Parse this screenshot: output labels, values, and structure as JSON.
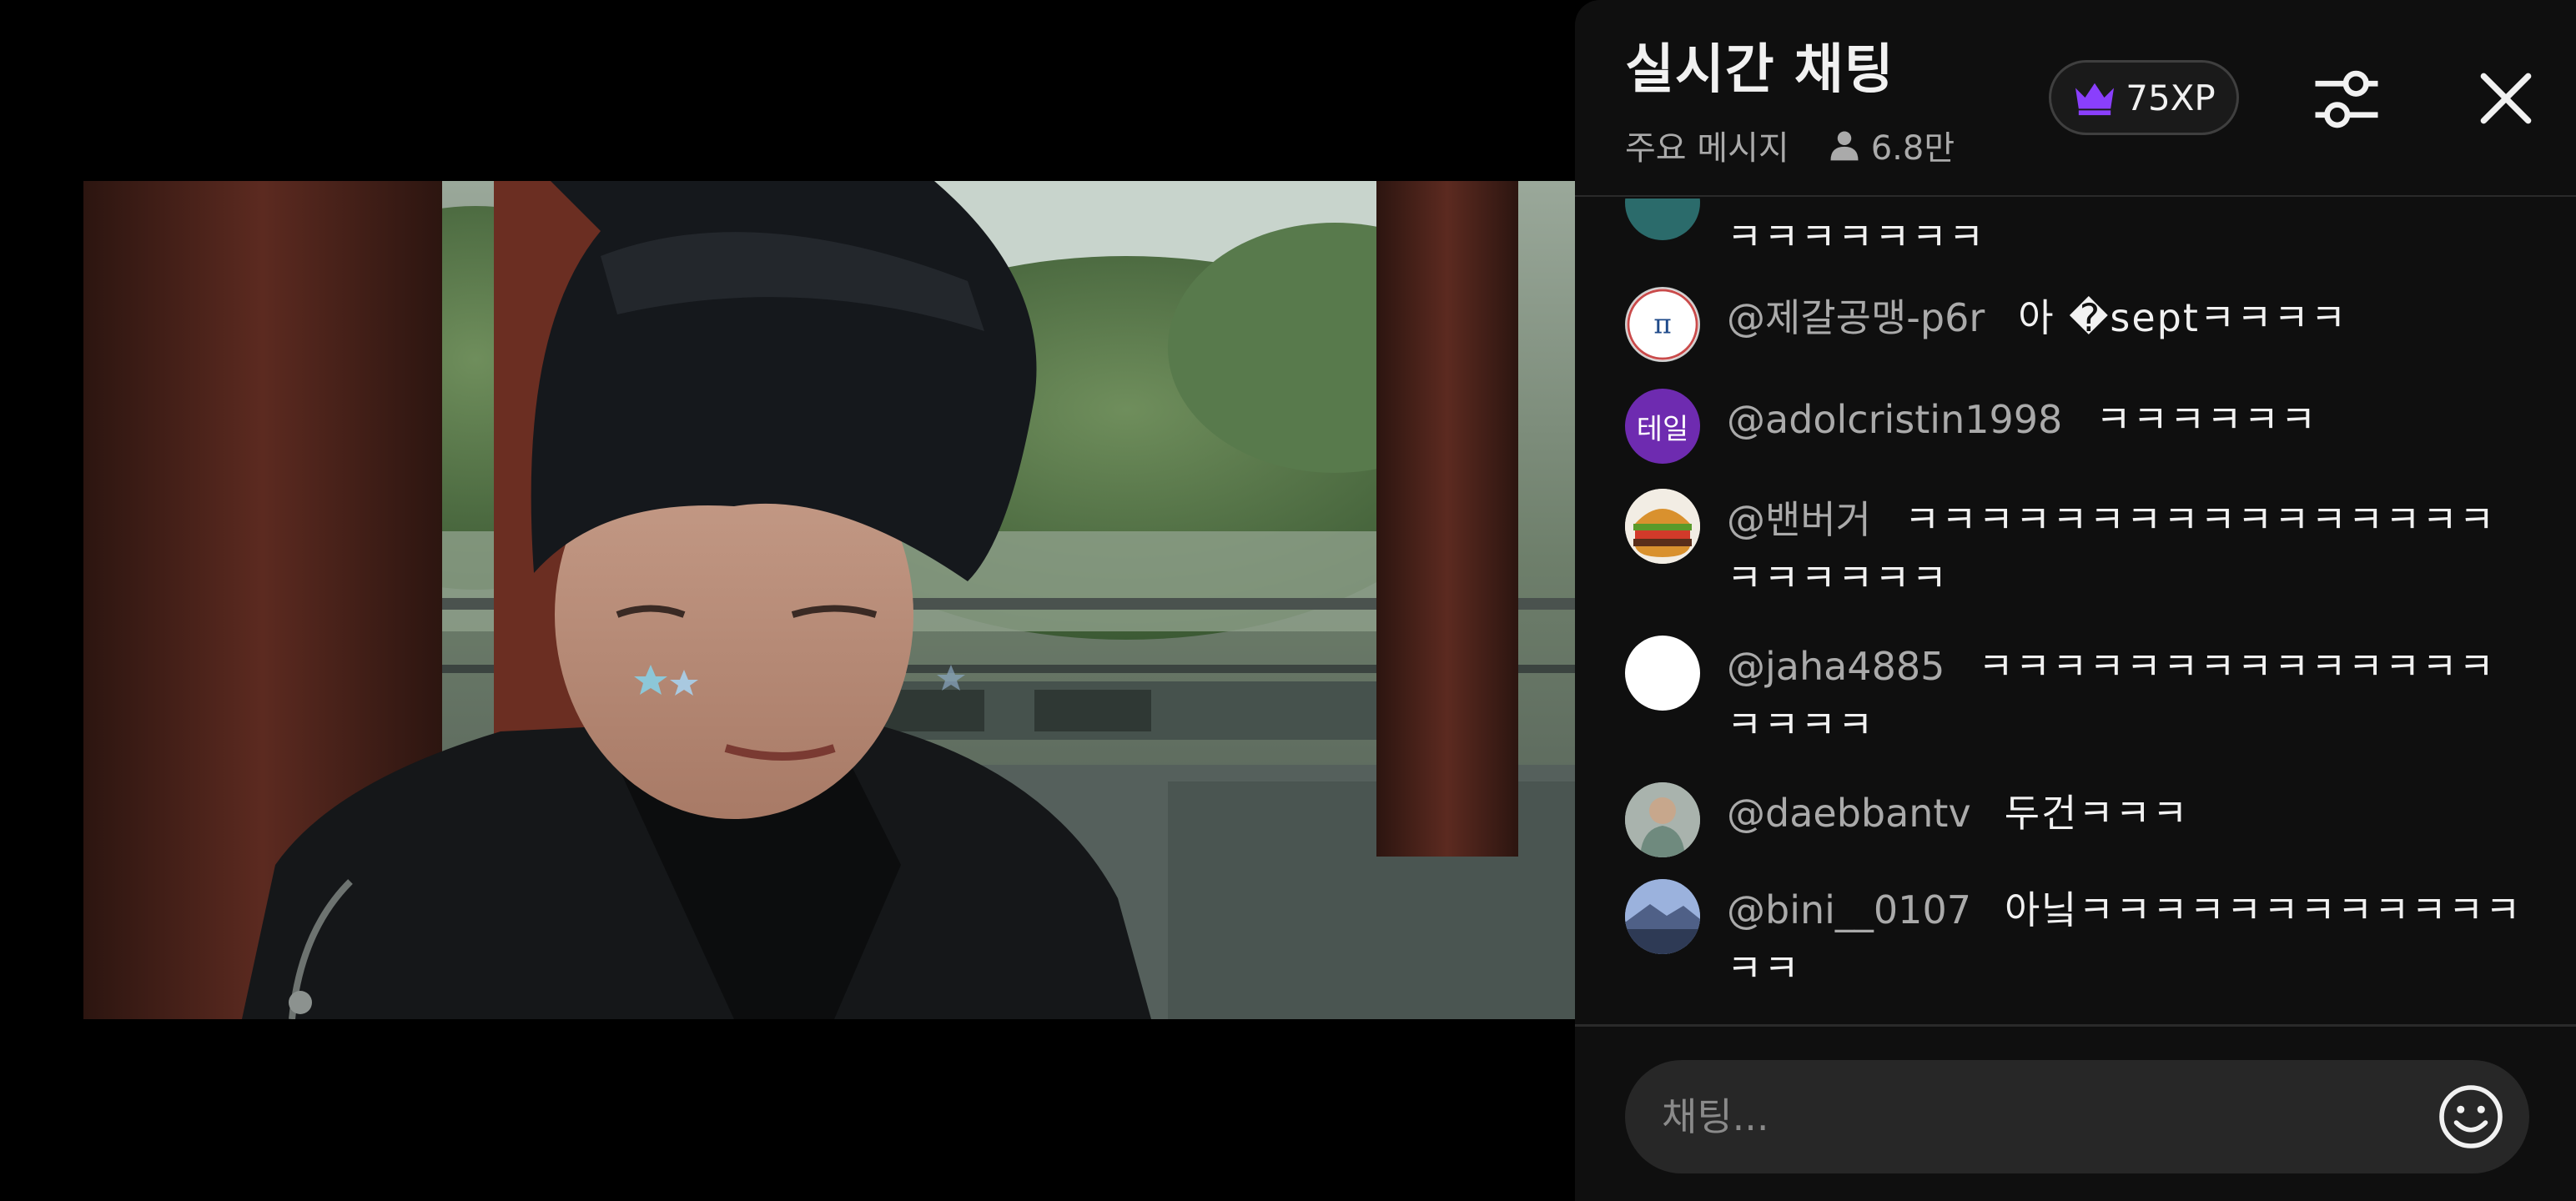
{
  "video": {
    "player_label": "video-player"
  },
  "chat": {
    "title": "실시간 채팅",
    "mode": "주요 메시지",
    "viewer_count": "6.8만",
    "xp_badge": "75XP",
    "icons": {
      "xp": "crown-icon",
      "filter": "sliders-icon",
      "close": "close-icon",
      "viewer": "person-icon",
      "emoji": "emoji-icon"
    },
    "partial_message": {
      "text": "ㅋㅋㅋㅋㅋㅋㅋ"
    },
    "messages": [
      {
        "author": "@제갈공맹-p6r",
        "text": "아 �septㅋㅋㅋㅋ",
        "avatar": "pi-logo"
      },
      {
        "author": "@adolcristin1998",
        "text": "ㅋㅋㅋㅋㅋㅋ",
        "avatar": "text-badge",
        "avatar_text": "테일",
        "avatar_color": "#6e2bb0"
      },
      {
        "author": "@밴버거",
        "text": "ㅋㅋㅋㅋㅋㅋㅋㅋㅋㅋㅋㅋㅋㅋㅋㅋㅋㅋㅋㅋㅋㅋ",
        "avatar": "burger"
      },
      {
        "author": "@jaha4885",
        "text": "ㅋㅋㅋㅋㅋㅋㅋㅋㅋㅋㅋㅋㅋㅋㅋㅋㅋㅋ",
        "avatar": "white-circle"
      },
      {
        "author": "@daebbantv",
        "text": "두건ㅋㅋㅋ",
        "avatar": "person-photo"
      },
      {
        "author": "@bini__0107",
        "text": "아닠ㅋㅋㅋㅋㅋㅋㅋㅋㅋㅋㅋㅋㅋㅋ",
        "avatar": "landscape"
      }
    ],
    "input_placeholder": "채팅..."
  }
}
